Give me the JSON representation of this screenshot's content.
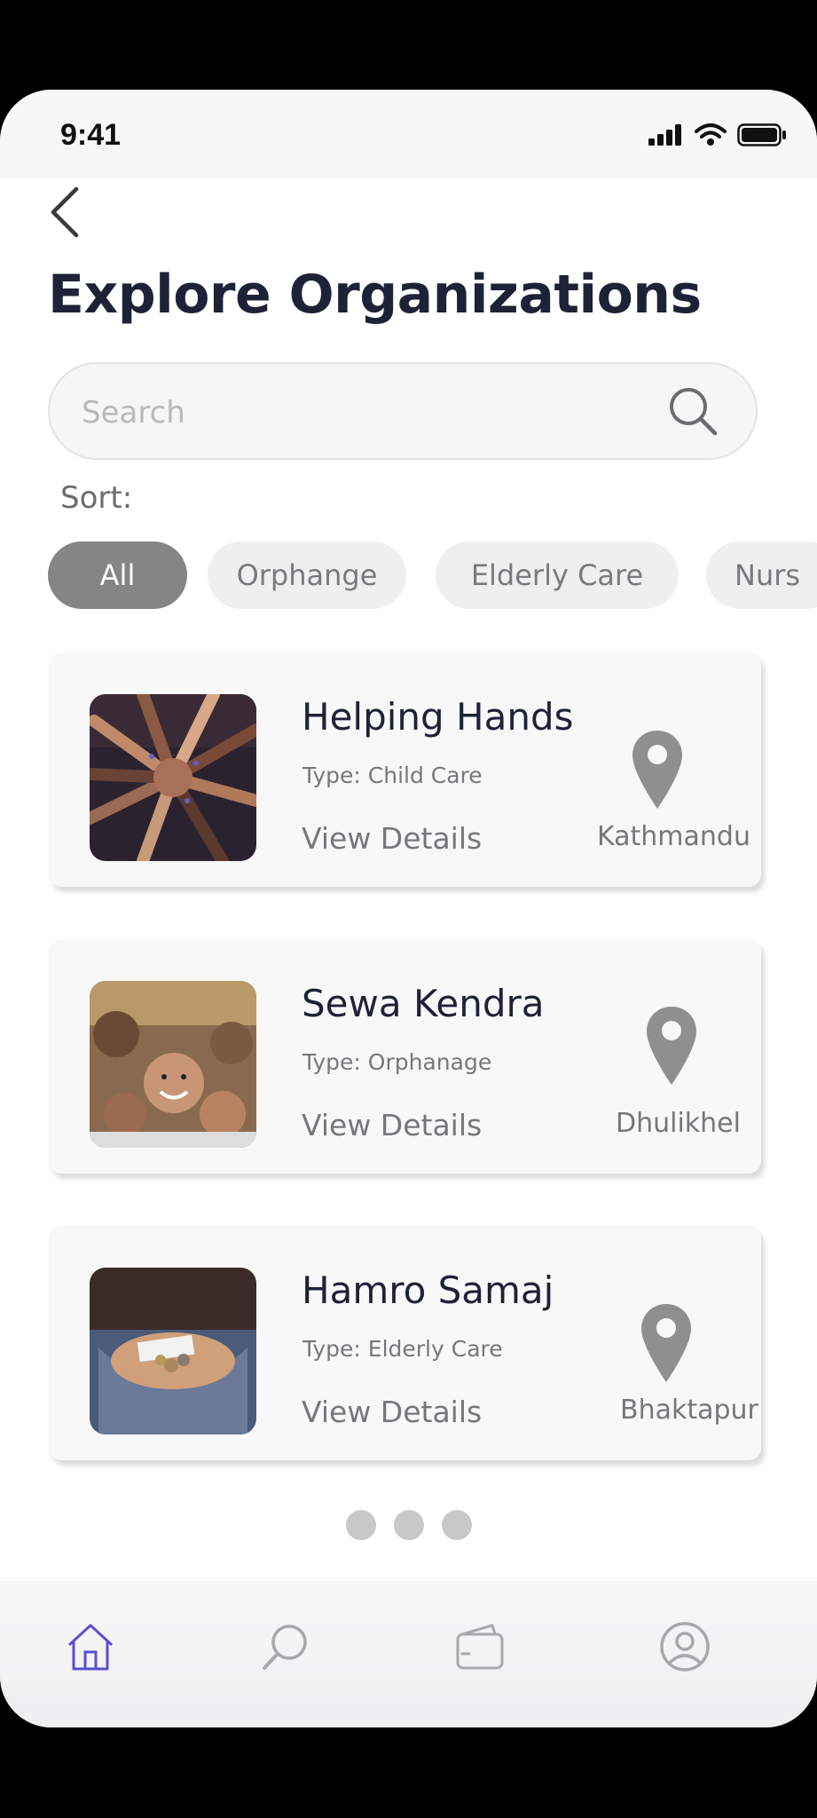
{
  "status_bar": {
    "time": "9:41"
  },
  "header": {
    "title": "Explore Organizations"
  },
  "search": {
    "placeholder": "Search"
  },
  "sort": {
    "label": "Sort:",
    "chips": [
      "All",
      "Orphange",
      "Elderly Care",
      "Nurs"
    ],
    "selected": "All"
  },
  "organizations": [
    {
      "name": "Helping Hands",
      "type": "Type: Child Care",
      "action": "View Details",
      "location": "Kathmandu"
    },
    {
      "name": "Sewa Kendra",
      "type": "Type: Orphanage",
      "action": "View Details",
      "location": "Dhulikhel"
    },
    {
      "name": "Hamro Samaj",
      "type": "Type: Elderly Care",
      "action": "View Details",
      "location": "Bhaktapur"
    }
  ],
  "pagination": {
    "pages": 3
  },
  "tabbar": {
    "items": [
      "home-icon",
      "search-icon",
      "wallet-icon",
      "profile-icon"
    ],
    "active": "home-icon",
    "active_color": "#5a4fcf",
    "inactive_color": "#a8a8ac"
  },
  "colors": {
    "title": "#1e2236",
    "chip_active": "#858585",
    "pin": "#8f8f8f"
  }
}
